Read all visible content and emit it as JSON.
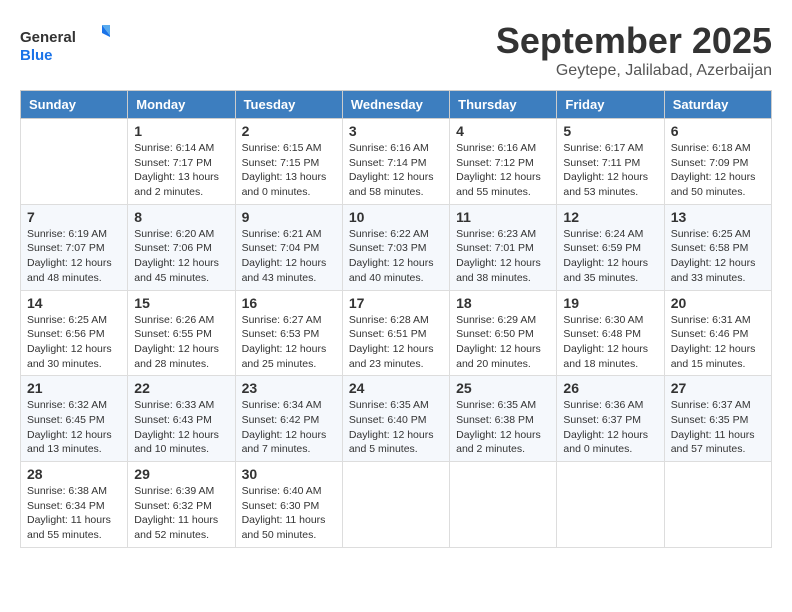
{
  "header": {
    "logo_general": "General",
    "logo_blue": "Blue",
    "month_title": "September 2025",
    "location": "Geytepe, Jalilabad, Azerbaijan"
  },
  "days_of_week": [
    "Sunday",
    "Monday",
    "Tuesday",
    "Wednesday",
    "Thursday",
    "Friday",
    "Saturday"
  ],
  "weeks": [
    [
      {
        "day": "",
        "sunrise": "",
        "sunset": "",
        "daylight": ""
      },
      {
        "day": "1",
        "sunrise": "Sunrise: 6:14 AM",
        "sunset": "Sunset: 7:17 PM",
        "daylight": "Daylight: 13 hours and 2 minutes."
      },
      {
        "day": "2",
        "sunrise": "Sunrise: 6:15 AM",
        "sunset": "Sunset: 7:15 PM",
        "daylight": "Daylight: 13 hours and 0 minutes."
      },
      {
        "day": "3",
        "sunrise": "Sunrise: 6:16 AM",
        "sunset": "Sunset: 7:14 PM",
        "daylight": "Daylight: 12 hours and 58 minutes."
      },
      {
        "day": "4",
        "sunrise": "Sunrise: 6:16 AM",
        "sunset": "Sunset: 7:12 PM",
        "daylight": "Daylight: 12 hours and 55 minutes."
      },
      {
        "day": "5",
        "sunrise": "Sunrise: 6:17 AM",
        "sunset": "Sunset: 7:11 PM",
        "daylight": "Daylight: 12 hours and 53 minutes."
      },
      {
        "day": "6",
        "sunrise": "Sunrise: 6:18 AM",
        "sunset": "Sunset: 7:09 PM",
        "daylight": "Daylight: 12 hours and 50 minutes."
      }
    ],
    [
      {
        "day": "7",
        "sunrise": "Sunrise: 6:19 AM",
        "sunset": "Sunset: 7:07 PM",
        "daylight": "Daylight: 12 hours and 48 minutes."
      },
      {
        "day": "8",
        "sunrise": "Sunrise: 6:20 AM",
        "sunset": "Sunset: 7:06 PM",
        "daylight": "Daylight: 12 hours and 45 minutes."
      },
      {
        "day": "9",
        "sunrise": "Sunrise: 6:21 AM",
        "sunset": "Sunset: 7:04 PM",
        "daylight": "Daylight: 12 hours and 43 minutes."
      },
      {
        "day": "10",
        "sunrise": "Sunrise: 6:22 AM",
        "sunset": "Sunset: 7:03 PM",
        "daylight": "Daylight: 12 hours and 40 minutes."
      },
      {
        "day": "11",
        "sunrise": "Sunrise: 6:23 AM",
        "sunset": "Sunset: 7:01 PM",
        "daylight": "Daylight: 12 hours and 38 minutes."
      },
      {
        "day": "12",
        "sunrise": "Sunrise: 6:24 AM",
        "sunset": "Sunset: 6:59 PM",
        "daylight": "Daylight: 12 hours and 35 minutes."
      },
      {
        "day": "13",
        "sunrise": "Sunrise: 6:25 AM",
        "sunset": "Sunset: 6:58 PM",
        "daylight": "Daylight: 12 hours and 33 minutes."
      }
    ],
    [
      {
        "day": "14",
        "sunrise": "Sunrise: 6:25 AM",
        "sunset": "Sunset: 6:56 PM",
        "daylight": "Daylight: 12 hours and 30 minutes."
      },
      {
        "day": "15",
        "sunrise": "Sunrise: 6:26 AM",
        "sunset": "Sunset: 6:55 PM",
        "daylight": "Daylight: 12 hours and 28 minutes."
      },
      {
        "day": "16",
        "sunrise": "Sunrise: 6:27 AM",
        "sunset": "Sunset: 6:53 PM",
        "daylight": "Daylight: 12 hours and 25 minutes."
      },
      {
        "day": "17",
        "sunrise": "Sunrise: 6:28 AM",
        "sunset": "Sunset: 6:51 PM",
        "daylight": "Daylight: 12 hours and 23 minutes."
      },
      {
        "day": "18",
        "sunrise": "Sunrise: 6:29 AM",
        "sunset": "Sunset: 6:50 PM",
        "daylight": "Daylight: 12 hours and 20 minutes."
      },
      {
        "day": "19",
        "sunrise": "Sunrise: 6:30 AM",
        "sunset": "Sunset: 6:48 PM",
        "daylight": "Daylight: 12 hours and 18 minutes."
      },
      {
        "day": "20",
        "sunrise": "Sunrise: 6:31 AM",
        "sunset": "Sunset: 6:46 PM",
        "daylight": "Daylight: 12 hours and 15 minutes."
      }
    ],
    [
      {
        "day": "21",
        "sunrise": "Sunrise: 6:32 AM",
        "sunset": "Sunset: 6:45 PM",
        "daylight": "Daylight: 12 hours and 13 minutes."
      },
      {
        "day": "22",
        "sunrise": "Sunrise: 6:33 AM",
        "sunset": "Sunset: 6:43 PM",
        "daylight": "Daylight: 12 hours and 10 minutes."
      },
      {
        "day": "23",
        "sunrise": "Sunrise: 6:34 AM",
        "sunset": "Sunset: 6:42 PM",
        "daylight": "Daylight: 12 hours and 7 minutes."
      },
      {
        "day": "24",
        "sunrise": "Sunrise: 6:35 AM",
        "sunset": "Sunset: 6:40 PM",
        "daylight": "Daylight: 12 hours and 5 minutes."
      },
      {
        "day": "25",
        "sunrise": "Sunrise: 6:35 AM",
        "sunset": "Sunset: 6:38 PM",
        "daylight": "Daylight: 12 hours and 2 minutes."
      },
      {
        "day": "26",
        "sunrise": "Sunrise: 6:36 AM",
        "sunset": "Sunset: 6:37 PM",
        "daylight": "Daylight: 12 hours and 0 minutes."
      },
      {
        "day": "27",
        "sunrise": "Sunrise: 6:37 AM",
        "sunset": "Sunset: 6:35 PM",
        "daylight": "Daylight: 11 hours and 57 minutes."
      }
    ],
    [
      {
        "day": "28",
        "sunrise": "Sunrise: 6:38 AM",
        "sunset": "Sunset: 6:34 PM",
        "daylight": "Daylight: 11 hours and 55 minutes."
      },
      {
        "day": "29",
        "sunrise": "Sunrise: 6:39 AM",
        "sunset": "Sunset: 6:32 PM",
        "daylight": "Daylight: 11 hours and 52 minutes."
      },
      {
        "day": "30",
        "sunrise": "Sunrise: 6:40 AM",
        "sunset": "Sunset: 6:30 PM",
        "daylight": "Daylight: 11 hours and 50 minutes."
      },
      {
        "day": "",
        "sunrise": "",
        "sunset": "",
        "daylight": ""
      },
      {
        "day": "",
        "sunrise": "",
        "sunset": "",
        "daylight": ""
      },
      {
        "day": "",
        "sunrise": "",
        "sunset": "",
        "daylight": ""
      },
      {
        "day": "",
        "sunrise": "",
        "sunset": "",
        "daylight": ""
      }
    ]
  ]
}
